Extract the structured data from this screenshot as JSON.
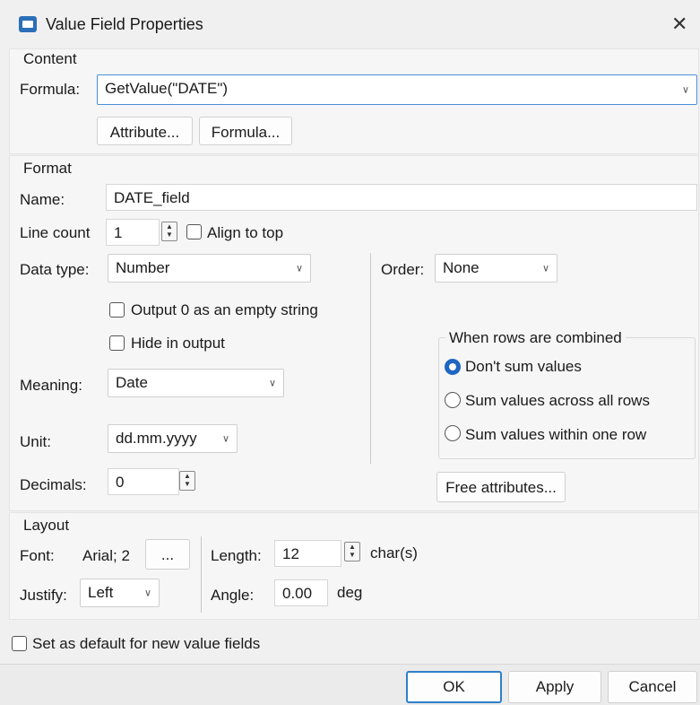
{
  "window": {
    "title": "Value Field Properties",
    "close_glyph": "✕"
  },
  "content": {
    "heading": "Content",
    "formula_label": "Formula:",
    "formula_value": "GetValue(\"DATE\")",
    "attribute_button": "Attribute...",
    "formula_button": "Formula..."
  },
  "format": {
    "heading": "Format",
    "name_label": "Name:",
    "name_value": "DATE_field",
    "line_count_label": "Line count",
    "line_count_value": "1",
    "align_top_label": "Align to top",
    "data_type_label": "Data type:",
    "data_type_value": "Number",
    "order_label": "Order:",
    "order_value": "None",
    "output_zero_label": "Output 0 as an empty string",
    "hide_output_label": "Hide in output",
    "meaning_label": "Meaning:",
    "meaning_value": "Date",
    "unit_label": "Unit:",
    "unit_value": "dd.mm.yyyy",
    "decimals_label": "Decimals:",
    "decimals_value": "0",
    "combine_group_label": "When rows are combined",
    "combine_options": [
      "Don't sum values",
      "Sum values across all rows",
      "Sum values within one row"
    ],
    "combine_selected": "Don't sum values",
    "free_attributes_button": "Free attributes..."
  },
  "layout": {
    "heading": "Layout",
    "font_label": "Font:",
    "font_value": "Arial; 2",
    "font_button": "...",
    "length_label": "Length:",
    "length_value": "12",
    "length_unit": "char(s)",
    "justify_label": "Justify:",
    "justify_value": "Left",
    "angle_label": "Angle:",
    "angle_value": "0.00",
    "angle_unit": "deg"
  },
  "default_checkbox_label": "Set as default for new value fields",
  "footer": {
    "ok": "OK",
    "apply": "Apply",
    "cancel": "Cancel"
  },
  "icons": {
    "dropdown": "chevron-down-icon",
    "app": "window-app-icon",
    "close": "close-icon"
  },
  "colors": {
    "accent": "#1f66c1",
    "background": "#f0f0f0"
  }
}
